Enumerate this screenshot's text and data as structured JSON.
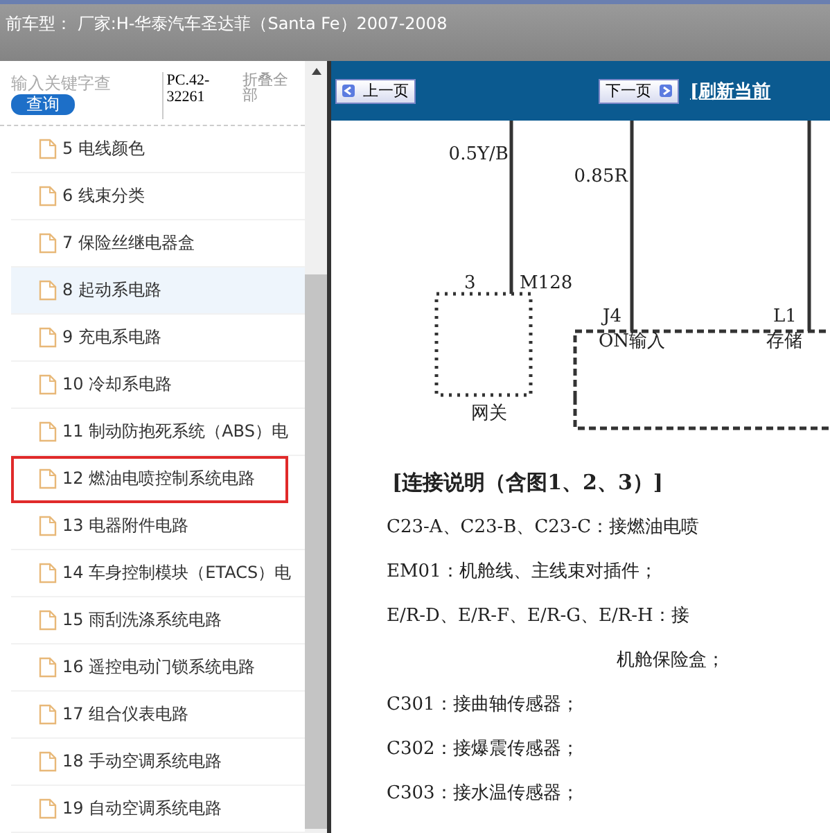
{
  "title_bar": {
    "text": "前车型： 厂家:H-华泰汽车圣达菲（Santa Fe）2007-2008"
  },
  "sidebar": {
    "search": {
      "placeholder": "输入关键字查"
    },
    "search_button": "查询",
    "code": "PC.42-32261",
    "collapse_link": "折叠全部",
    "items": [
      {
        "label": "5 电线颜色",
        "selected": false,
        "outlined": false
      },
      {
        "label": "6 线束分类",
        "selected": false,
        "outlined": false
      },
      {
        "label": "7 保险丝继电器盒",
        "selected": false,
        "outlined": false
      },
      {
        "label": "8 起动系电路",
        "selected": true,
        "outlined": false
      },
      {
        "label": "9 充电系电路",
        "selected": false,
        "outlined": false
      },
      {
        "label": "10 冷却系电路",
        "selected": false,
        "outlined": false
      },
      {
        "label": "11 制动防抱死系统（ABS）电",
        "selected": false,
        "outlined": false
      },
      {
        "label": "12 燃油电喷控制系统电路",
        "selected": false,
        "outlined": true
      },
      {
        "label": "13 电器附件电路",
        "selected": false,
        "outlined": false
      },
      {
        "label": "14 车身控制模块（ETACS）电",
        "selected": false,
        "outlined": false
      },
      {
        "label": "15 雨刮洗涤系统电路",
        "selected": false,
        "outlined": false
      },
      {
        "label": "16 遥控电动门锁系统电路",
        "selected": false,
        "outlined": false
      },
      {
        "label": "17 组合仪表电路",
        "selected": false,
        "outlined": false
      },
      {
        "label": "18 手动空调系统电路",
        "selected": false,
        "outlined": false
      },
      {
        "label": "19 自动空调系统电路",
        "selected": false,
        "outlined": false
      }
    ]
  },
  "toolbar": {
    "prev_button": "上一页",
    "next_button": "下一页",
    "refresh_link": "[刷新当前"
  },
  "document": {
    "diagram": {
      "wire_labels": [
        "0.5Y/B",
        "0.85R"
      ],
      "gateway_pin": "3",
      "gateway_connector": "M128",
      "gateway_label": "网关",
      "pin_j4": "J4",
      "pin_j4_label": "ON输入",
      "pin_l1": "L1",
      "pin_l1_label": "存储"
    },
    "heading": "[连接说明（含图1、2、3）]",
    "lines": [
      {
        "text": "C23-A、C23-B、C23-C：接燃油电喷",
        "indent": false
      },
      {
        "text": "EM01：机舱线、主线束对插件；",
        "indent": false
      },
      {
        "text": "E/R-D、E/R-F、E/R-G、E/R-H：接",
        "indent": false
      },
      {
        "text": "机舱保险盒；",
        "indent": true
      },
      {
        "text": "C301：接曲轴传感器；",
        "indent": false
      },
      {
        "text": "C302：接爆震传感器；",
        "indent": false
      },
      {
        "text": "C303：接水温传感器；",
        "indent": false
      }
    ]
  }
}
